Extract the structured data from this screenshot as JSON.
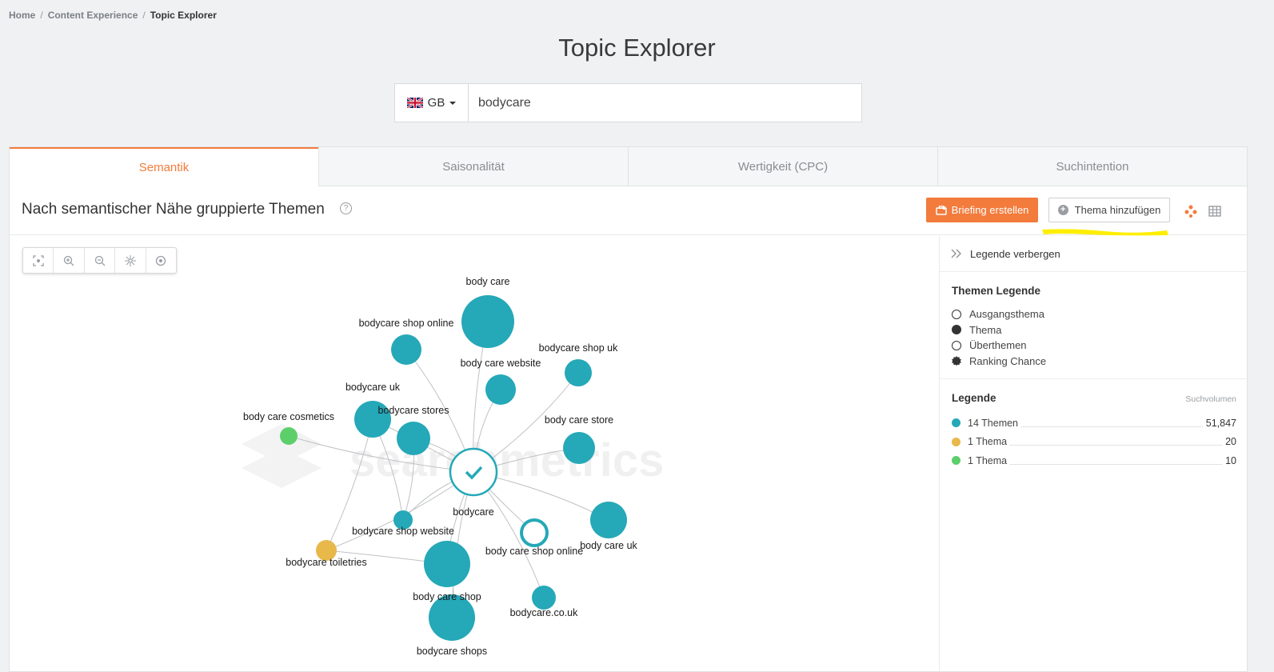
{
  "breadcrumb": {
    "items": [
      "Home",
      "Content Experience"
    ],
    "separator": "/",
    "current": "Topic Explorer"
  },
  "page_title": "Topic Explorer",
  "search": {
    "country": "GB",
    "value": "bodycare"
  },
  "tabs": [
    {
      "label": "Semantik",
      "active": true
    },
    {
      "label": "Saisonalität",
      "active": false
    },
    {
      "label": "Wertigkeit (CPC)",
      "active": false
    },
    {
      "label": "Suchintention",
      "active": false
    }
  ],
  "section": {
    "title": "Nach semantischer Nähe gruppierte Themen",
    "help": "?",
    "briefing_button": "Briefing erstellen",
    "add_topic_button": "Thema hinzufügen"
  },
  "colors": {
    "accent": "#f37b3c",
    "teal": "#25a8b8",
    "yellow": "#e8b84b",
    "green": "#5ccf6b",
    "highlight": "#ffee00"
  },
  "graph": {
    "watermark": "searchmetrics",
    "center": {
      "label": "bodycare"
    },
    "nodes": [
      {
        "label": "body care",
        "type": "topic",
        "color": "teal"
      },
      {
        "label": "bodycare shop online",
        "type": "topic",
        "color": "teal"
      },
      {
        "label": "body care website",
        "type": "topic",
        "color": "teal"
      },
      {
        "label": "bodycare shop uk",
        "type": "topic",
        "color": "teal"
      },
      {
        "label": "bodycare uk",
        "type": "topic",
        "color": "teal"
      },
      {
        "label": "bodycare stores",
        "type": "topic",
        "color": "teal"
      },
      {
        "label": "body care cosmetics",
        "type": "topic",
        "color": "green"
      },
      {
        "label": "body care store",
        "type": "topic",
        "color": "teal"
      },
      {
        "label": "bodycare shop website",
        "type": "topic",
        "color": "teal"
      },
      {
        "label": "bodycare toiletries",
        "type": "topic",
        "color": "yellow"
      },
      {
        "label": "body care shop online",
        "type": "supertopic",
        "color": "teal"
      },
      {
        "label": "body care uk",
        "type": "topic",
        "color": "teal"
      },
      {
        "label": "body care shop",
        "type": "topic",
        "color": "teal"
      },
      {
        "label": "bodycare.co.uk",
        "type": "topic",
        "color": "teal"
      },
      {
        "label": "bodycare shops",
        "type": "topic",
        "color": "teal"
      }
    ]
  },
  "legend": {
    "toggle_label": "Legende verbergen",
    "themes_title": "Themen Legende",
    "themes": [
      {
        "label": "Ausgangsthema",
        "icon": "hollow-circle-icon"
      },
      {
        "label": "Thema",
        "icon": "solid-circle-icon"
      },
      {
        "label": "Überthemen",
        "icon": "hollow-circle-icon"
      },
      {
        "label": "Ranking Chance",
        "icon": "badge-icon"
      }
    ],
    "volume_title": "Legende",
    "volume_header": "Suchvolumen",
    "volume_rows": [
      {
        "label": "14 Themen",
        "value": "51,847",
        "color": "teal"
      },
      {
        "label": "1 Thema",
        "value": "20",
        "color": "yellow"
      },
      {
        "label": "1 Thema",
        "value": "10",
        "color": "green"
      }
    ]
  }
}
